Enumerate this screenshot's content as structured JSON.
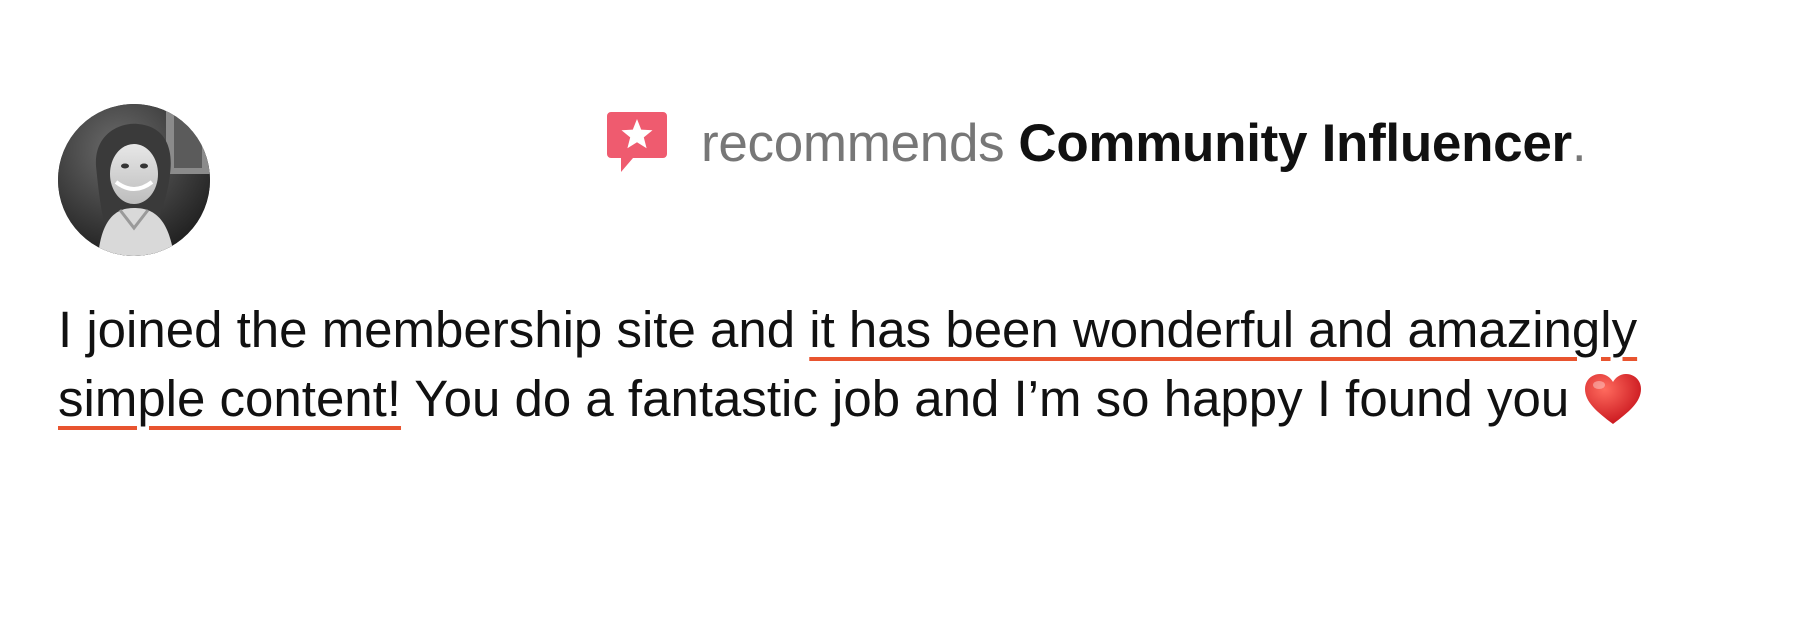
{
  "header": {
    "recommends_label": "recommends",
    "page_name": "Community Influencer",
    "period": "."
  },
  "review": {
    "text_part1": "I joined the membership site and ",
    "text_highlight": "it has been wonderful and amazingly simple content!",
    "text_part2": " You do a fantastic job and I’m so happy I found you",
    "emoji": "heart-icon"
  },
  "icons": {
    "recommend_icon": "star-speech-bubble-icon",
    "reviewer_avatar": "avatar"
  },
  "colors": {
    "recommend_icon": "#ef5b6f",
    "highlight_underline": "#e8542f",
    "muted_text": "#777777",
    "heart": "#e8322e"
  }
}
